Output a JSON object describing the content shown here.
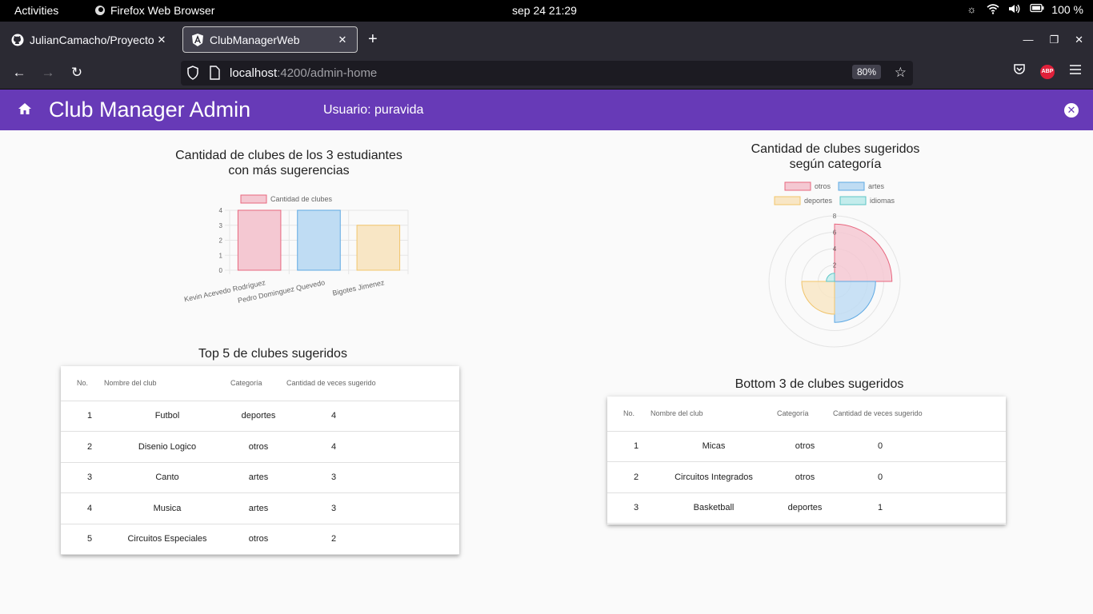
{
  "system": {
    "activities": "Activities",
    "app_name": "Firefox Web Browser",
    "clock": "sep 24  21:29",
    "battery": "100 %"
  },
  "browser": {
    "tabs": [
      {
        "title": "JulianCamacho/Proyecto",
        "icon": "github-icon"
      },
      {
        "title": "ClubManagerWeb",
        "icon": "angular-icon"
      }
    ],
    "url_host": "localhost",
    "url_rest": ":4200/admin-home",
    "zoom": "80%",
    "abp_label": "ABP"
  },
  "header": {
    "title": "Club Manager Admin",
    "user": "Usuario: puravida",
    "color": "#673ab7"
  },
  "bar_section": {
    "title_line1": "Cantidad de clubes de los 3 estudiantes",
    "title_line2": "con más sugerencias"
  },
  "polar_section": {
    "title_line1": "Cantidad de clubes sugeridos",
    "title_line2": "según categoría"
  },
  "chart_data": [
    {
      "type": "bar",
      "categories": [
        "Kevin Acevedo Rodríguez",
        "Pedro Dominguez Quevedo",
        "Bigotes Jimenez"
      ],
      "series": [
        {
          "name": "Cantidad de clubes",
          "values": [
            4,
            4,
            3
          ]
        }
      ],
      "bar_colors": [
        "#f4c8d2",
        "#bfdcf3",
        "#f8e6c5"
      ],
      "bar_borders": [
        "#e8677f",
        "#5ea9e3",
        "#f2c56b"
      ],
      "yticks": [
        "0",
        "1",
        "2",
        "3",
        "4"
      ],
      "ylim": [
        0,
        4
      ],
      "grid": true,
      "legend": "top"
    },
    {
      "type": "polarArea",
      "categories": [
        "otros",
        "artes",
        "deportes",
        "idiomas"
      ],
      "values": [
        7,
        5,
        4,
        1
      ],
      "colors": [
        "#f4c8d2",
        "#bfdcf3",
        "#f8e6c5",
        "#c3ecec"
      ],
      "borders": [
        "#e8677f",
        "#5ea9e3",
        "#f2c56b",
        "#5ec6c6"
      ],
      "rticks": [
        "2",
        "4",
        "6",
        "8"
      ],
      "rlim": [
        0,
        8
      ],
      "legend": "top"
    }
  ],
  "top_table": {
    "title": "Top 5 de clubes sugeridos",
    "headers": [
      "No.",
      "Nombre del club",
      "Categoría",
      "Cantidad de veces sugerido"
    ],
    "rows": [
      [
        "1",
        "Futbol",
        "deportes",
        "4"
      ],
      [
        "2",
        "Disenio Logico",
        "otros",
        "4"
      ],
      [
        "3",
        "Canto",
        "artes",
        "3"
      ],
      [
        "4",
        "Musica",
        "artes",
        "3"
      ],
      [
        "5",
        "Circuitos Especiales",
        "otros",
        "2"
      ]
    ]
  },
  "bottom_table": {
    "title": "Bottom 3 de clubes sugeridos",
    "headers": [
      "No.",
      "Nombre del club",
      "Categoría",
      "Cantidad de veces sugerido"
    ],
    "rows": [
      [
        "1",
        "Micas",
        "otros",
        "0"
      ],
      [
        "2",
        "Circuitos Integrados",
        "otros",
        "0"
      ],
      [
        "3",
        "Basketball",
        "deportes",
        "1"
      ]
    ]
  }
}
